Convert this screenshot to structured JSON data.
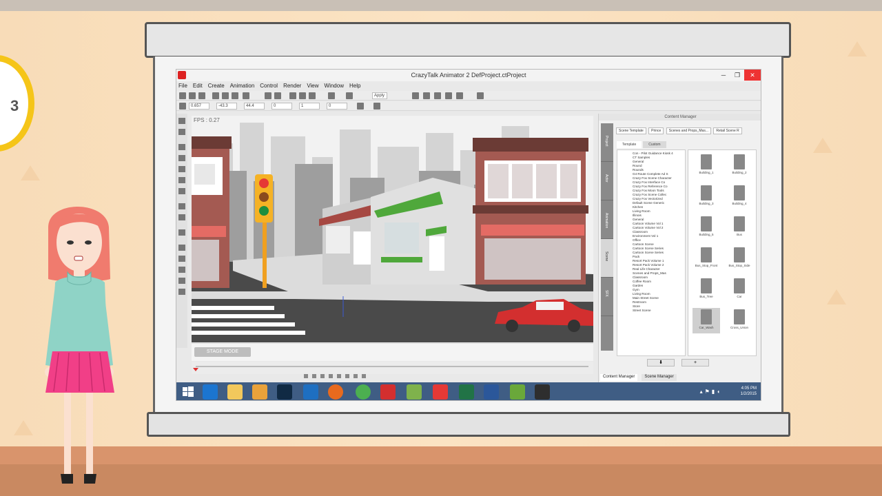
{
  "clock": {
    "number": "3"
  },
  "window": {
    "title": "CrazyTalk Animator 2    DefProject.ctProject",
    "controls": {
      "minimize": "─",
      "maximize": "❐",
      "close": "✕"
    }
  },
  "menu": [
    "File",
    "Edit",
    "Create",
    "Animation",
    "Control",
    "Render",
    "View",
    "Window",
    "Help"
  ],
  "toolbar": {
    "field_a": "Apply",
    "field_x": "0.657",
    "field_y": "-43.3",
    "field_z": "44.4",
    "field_w": "0",
    "field_h": "1",
    "field_s": "0"
  },
  "stage": {
    "fps_text": "FPS : 0.27",
    "mode_label": "STAGE MODE"
  },
  "content_manager": {
    "title": "Content Manager",
    "path": [
      "Scene Template",
      "Prince",
      "Scenes and Props_Mas...",
      "Retail Scene R"
    ],
    "tabs": [
      "Template",
      "Custom"
    ],
    "side_tabs": [
      "Project",
      "Actor",
      "Animation",
      "Scene",
      "SFX"
    ],
    "tree": [
      "Con - Pilot Guidance Kiosk 4",
      "CT Samples",
      "General",
      "Round",
      "Rounds",
      "G4 Route Complete Ad S",
      "Crazy Fox Scene Character",
      "Crazy Fox Interface Co",
      "Crazy Fox Reference Co",
      "Crazy Fox Moon Tools",
      "Crazy Fox Scene Collec",
      "Crazy Fox Vectorized",
      "Default Scene Generic",
      "Kitchen",
      "Living Room",
      "Illinois",
      "General",
      "Cartoon Volume Vol 1",
      "Cartoon Volume Vol 2",
      "Classroom",
      "Environment Vol 1",
      "Office",
      "Cartoon Scene",
      "Cartoon Scene Series",
      "Cartoon Scene Series",
      "Pack",
      "Resort Pack Volume 1",
      "Resort Pack Volume 2",
      "Real Life Character",
      "Scenes and Props_Mas",
      "Classroom",
      "Coffee Room",
      "Garden",
      "Gym",
      "Living Room",
      "Main Street Scene",
      "Restroom",
      "Store",
      "Street Scene"
    ],
    "thumbs": [
      "Building_1",
      "Building_2",
      "Building_3",
      "Building_4",
      "Building_5",
      "Bus",
      "Bus_Stop_Front",
      "Bus_Stop_Side",
      "Bus_Tree",
      "Car",
      "Car_Wash",
      "Cross_Union"
    ],
    "buttons": {
      "down": "⬇",
      "add": "+"
    },
    "bottom_tabs": [
      "Content Manager",
      "Scene Manager"
    ]
  },
  "taskbar": {
    "time": "4:05 PM",
    "date": "1/2/2015"
  },
  "colors": {
    "taskbar": "#3f5d84",
    "close": "#e33333",
    "clock_rim": "#f5c518"
  }
}
